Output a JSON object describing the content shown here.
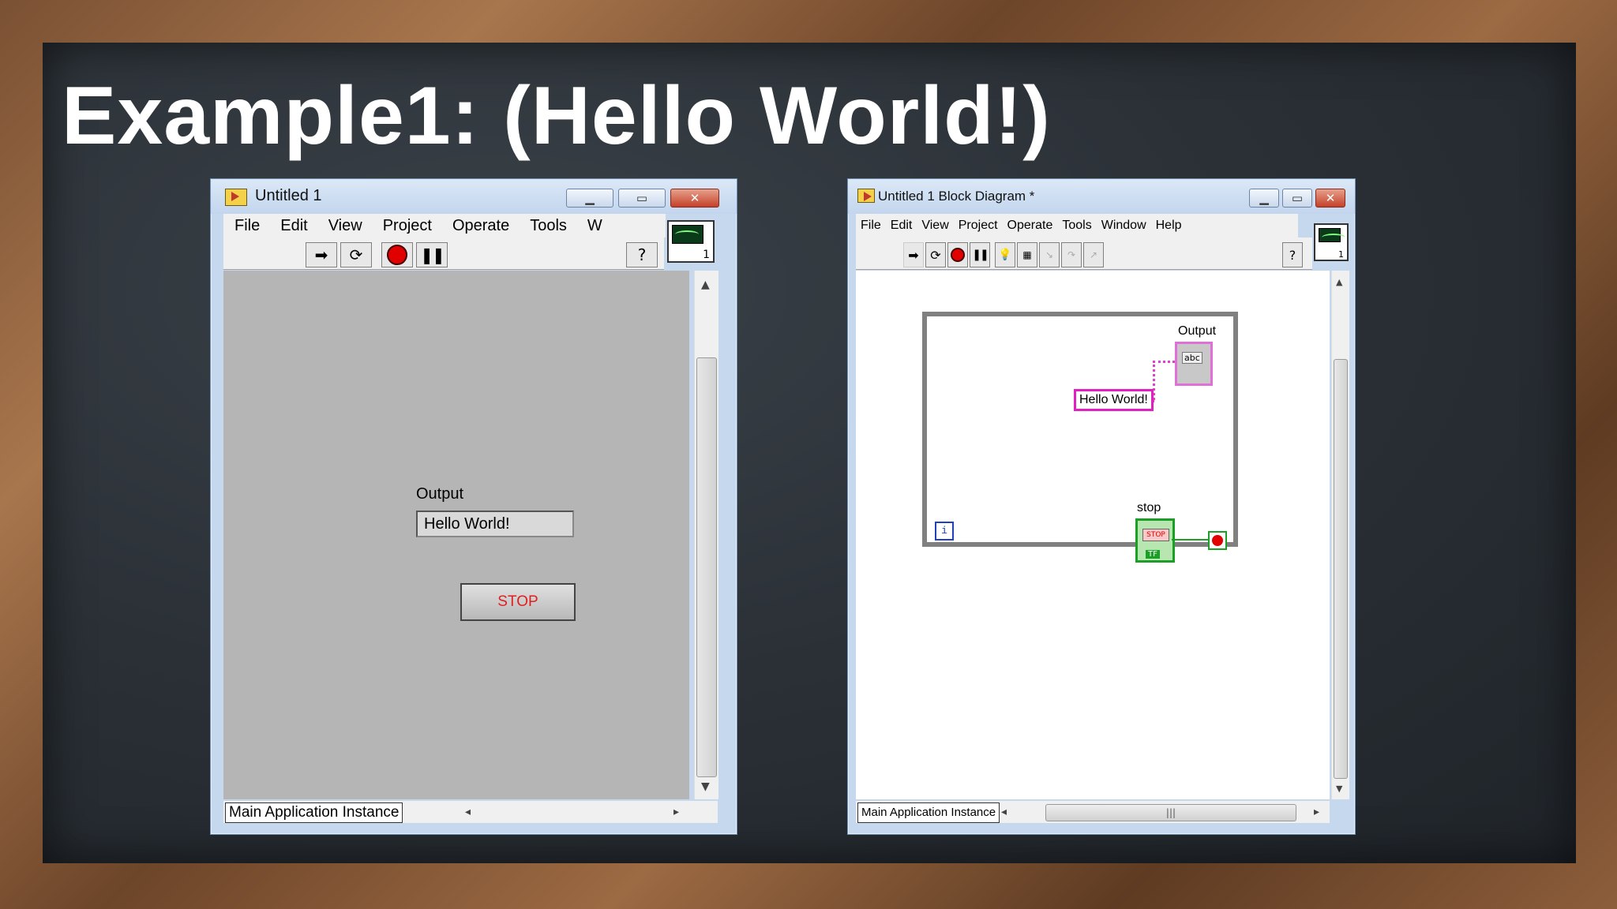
{
  "slide": {
    "title": "Example1: (Hello World!)"
  },
  "front_panel": {
    "title": "Untitled 1",
    "menu": [
      "File",
      "Edit",
      "View",
      "Project",
      "Operate",
      "Tools",
      "W"
    ],
    "toolbar": [
      "run-arrow-icon",
      "run-continuously-icon",
      "abort-icon",
      "pause-icon",
      "help-icon"
    ],
    "output_label": "Output",
    "output_value": "Hello World!",
    "stop_label": "STOP",
    "status_instance": "Main Application Instance",
    "vi_icon_number": "1"
  },
  "block_diagram": {
    "title": "Untitled 1 Block Diagram *",
    "menu": [
      "File",
      "Edit",
      "View",
      "Project",
      "Operate",
      "Tools",
      "Window",
      "Help"
    ],
    "toolbar": [
      "run-arrow-icon",
      "run-continuously-icon",
      "abort-icon",
      "pause-icon",
      "highlight-execution-icon",
      "retain-wire-values-icon",
      "step-into-icon",
      "step-over-icon",
      "step-out-icon",
      "help-icon"
    ],
    "output_label": "Output",
    "output_terminal": "abc",
    "constant_text": "Hello World!",
    "stop_label": "stop",
    "stop_terminal": "STOP",
    "stop_tf": "TF",
    "iteration_terminal": "i",
    "status_instance": "Main Application Instance",
    "scroll_grip": "|||",
    "vi_icon_number": "1"
  },
  "colors": {
    "string_wire": "#e040d0",
    "boolean_wire": "#1aa024",
    "stop_text": "#e02020"
  }
}
